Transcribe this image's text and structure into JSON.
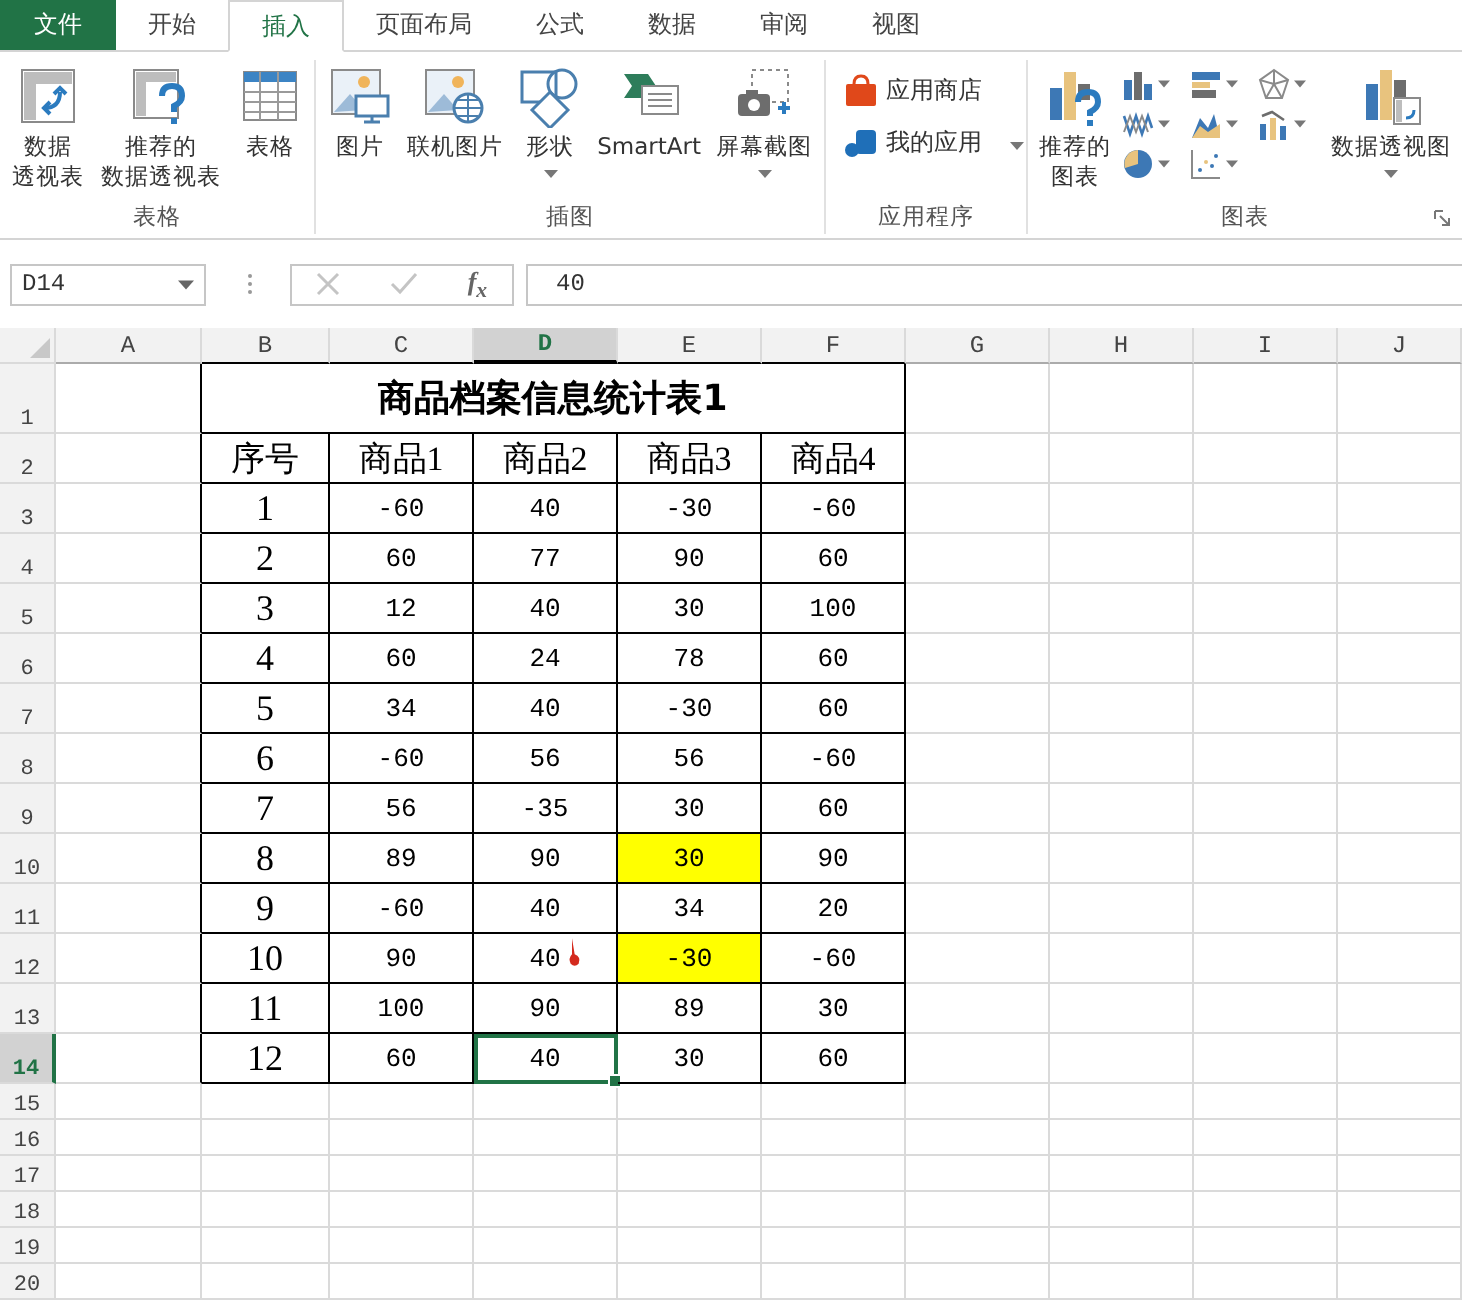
{
  "tabs": [
    {
      "label": "文件",
      "kind": "file",
      "selected": false
    },
    {
      "label": "开始",
      "kind": "tab",
      "selected": false
    },
    {
      "label": "插入",
      "kind": "tab",
      "selected": true
    },
    {
      "label": "页面布局",
      "kind": "tab",
      "selected": false
    },
    {
      "label": "公式",
      "kind": "tab",
      "selected": false
    },
    {
      "label": "数据",
      "kind": "tab",
      "selected": false
    },
    {
      "label": "审阅",
      "kind": "tab",
      "selected": false
    },
    {
      "label": "视图",
      "kind": "tab",
      "selected": false
    }
  ],
  "ribbon": {
    "groups": [
      {
        "label": "表格",
        "buttons": [
          {
            "lines": [
              "数据",
              "透视表"
            ],
            "kind": "large",
            "dropdown": false
          },
          {
            "lines": [
              "推荐的",
              "数据透视表"
            ],
            "kind": "large",
            "dropdown": false
          },
          {
            "lines": [
              "表格"
            ],
            "kind": "large",
            "dropdown": false
          }
        ]
      },
      {
        "label": "插图",
        "buttons": [
          {
            "lines": [
              "图片"
            ],
            "kind": "large",
            "dropdown": false
          },
          {
            "lines": [
              "联机图片"
            ],
            "kind": "large",
            "dropdown": false
          },
          {
            "lines": [
              "形状"
            ],
            "kind": "large",
            "dropdown": true
          },
          {
            "lines": [
              "SmartArt"
            ],
            "kind": "large",
            "dropdown": false
          },
          {
            "lines": [
              "屏幕截图"
            ],
            "kind": "large",
            "dropdown": true
          }
        ]
      },
      {
        "label": "应用程序",
        "buttons": [
          {
            "lines": [
              "应用商店"
            ],
            "kind": "row",
            "dropdown": false
          },
          {
            "lines": [
              "我的应用"
            ],
            "kind": "row",
            "dropdown": true
          }
        ]
      },
      {
        "label": "图表",
        "buttons": [
          {
            "lines": [
              "推荐的",
              "图表"
            ],
            "kind": "large",
            "dropdown": false
          },
          {
            "kind": "chart-grid",
            "dropdown": true
          },
          {
            "lines": [
              "数据透视图"
            ],
            "kind": "large",
            "dropdown": true
          }
        ]
      }
    ]
  },
  "formula_bar": {
    "name_box": "D14",
    "fx": "f$_{x}$",
    "value": "40"
  },
  "columns": [
    {
      "label": "A",
      "selected": false
    },
    {
      "label": "B",
      "selected": false
    },
    {
      "label": "C",
      "selected": false
    },
    {
      "label": "D",
      "selected": true
    },
    {
      "label": "E",
      "selected": false
    },
    {
      "label": "F",
      "selected": false
    },
    {
      "label": "G",
      "selected": false
    },
    {
      "label": "H",
      "selected": false
    },
    {
      "label": "I",
      "selected": false
    },
    {
      "label": "J",
      "selected": false
    }
  ],
  "row_numbers": [
    {
      "label": "1",
      "selected": false
    },
    {
      "label": "2",
      "selected": false
    },
    {
      "label": "3",
      "selected": false
    },
    {
      "label": "4",
      "selected": false
    },
    {
      "label": "5",
      "selected": false
    },
    {
      "label": "6",
      "selected": false
    },
    {
      "label": "7",
      "selected": false
    },
    {
      "label": "8",
      "selected": false
    },
    {
      "label": "9",
      "selected": false
    },
    {
      "label": "10",
      "selected": false
    },
    {
      "label": "11",
      "selected": false
    },
    {
      "label": "12",
      "selected": false
    },
    {
      "label": "13",
      "selected": false
    },
    {
      "label": "14",
      "selected": true
    },
    {
      "label": "15",
      "selected": false
    },
    {
      "label": "16",
      "selected": false
    },
    {
      "label": "17",
      "selected": false
    },
    {
      "label": "18",
      "selected": false
    },
    {
      "label": "19",
      "selected": false
    },
    {
      "label": "20",
      "selected": false
    }
  ],
  "table": {
    "title": "商品档案信息统计表1",
    "headers": [
      "序号",
      "商品1",
      "商品2",
      "商品3",
      "商品4"
    ],
    "rows": [
      {
        "seq": "1",
        "cells": [
          {
            "text": "-60",
            "highlighted": false,
            "selected": false
          },
          {
            "text": "40",
            "highlighted": false,
            "selected": false
          },
          {
            "text": "-30",
            "highlighted": false,
            "selected": false
          },
          {
            "text": "-60",
            "highlighted": false,
            "selected": false
          }
        ]
      },
      {
        "seq": "2",
        "cells": [
          {
            "text": "60",
            "highlighted": false,
            "selected": false
          },
          {
            "text": "77",
            "highlighted": false,
            "selected": false
          },
          {
            "text": "90",
            "highlighted": false,
            "selected": false
          },
          {
            "text": "60",
            "highlighted": false,
            "selected": false
          }
        ]
      },
      {
        "seq": "3",
        "cells": [
          {
            "text": "12",
            "highlighted": false,
            "selected": false
          },
          {
            "text": "40",
            "highlighted": false,
            "selected": false
          },
          {
            "text": "30",
            "highlighted": false,
            "selected": false
          },
          {
            "text": "100",
            "highlighted": false,
            "selected": false
          }
        ]
      },
      {
        "seq": "4",
        "cells": [
          {
            "text": "60",
            "highlighted": false,
            "selected": false
          },
          {
            "text": "24",
            "highlighted": false,
            "selected": false
          },
          {
            "text": "78",
            "highlighted": false,
            "selected": false
          },
          {
            "text": "60",
            "highlighted": false,
            "selected": false
          }
        ]
      },
      {
        "seq": "5",
        "cells": [
          {
            "text": "34",
            "highlighted": false,
            "selected": false
          },
          {
            "text": "40",
            "highlighted": false,
            "selected": false
          },
          {
            "text": "-30",
            "highlighted": false,
            "selected": false
          },
          {
            "text": "60",
            "highlighted": false,
            "selected": false
          }
        ]
      },
      {
        "seq": "6",
        "cells": [
          {
            "text": "-60",
            "highlighted": false,
            "selected": false
          },
          {
            "text": "56",
            "highlighted": false,
            "selected": false
          },
          {
            "text": "56",
            "highlighted": false,
            "selected": false
          },
          {
            "text": "-60",
            "highlighted": false,
            "selected": false
          }
        ]
      },
      {
        "seq": "7",
        "cells": [
          {
            "text": "56",
            "highlighted": false,
            "selected": false
          },
          {
            "text": "-35",
            "highlighted": false,
            "selected": false
          },
          {
            "text": "30",
            "highlighted": false,
            "selected": false
          },
          {
            "text": "60",
            "highlighted": false,
            "selected": false
          }
        ]
      },
      {
        "seq": "8",
        "cells": [
          {
            "text": "89",
            "highlighted": false,
            "selected": false
          },
          {
            "text": "90",
            "highlighted": false,
            "selected": false
          },
          {
            "text": "30",
            "highlighted": true,
            "selected": false
          },
          {
            "text": "90",
            "highlighted": false,
            "selected": false
          }
        ]
      },
      {
        "seq": "9",
        "cells": [
          {
            "text": "-60",
            "highlighted": false,
            "selected": false
          },
          {
            "text": "40",
            "highlighted": false,
            "selected": false
          },
          {
            "text": "34",
            "highlighted": false,
            "selected": false
          },
          {
            "text": "20",
            "highlighted": false,
            "selected": false
          }
        ]
      },
      {
        "seq": "10",
        "cells": [
          {
            "text": "90",
            "highlighted": false,
            "selected": false
          },
          {
            "text": "40",
            "highlighted": false,
            "selected": false
          },
          {
            "text": "-30",
            "highlighted": true,
            "selected": false
          },
          {
            "text": "-60",
            "highlighted": false,
            "selected": false
          }
        ]
      },
      {
        "seq": "11",
        "cells": [
          {
            "text": "100",
            "highlighted": false,
            "selected": false
          },
          {
            "text": "90",
            "highlighted": false,
            "selected": false
          },
          {
            "text": "89",
            "highlighted": false,
            "selected": false
          },
          {
            "text": "30",
            "highlighted": false,
            "selected": false
          }
        ]
      },
      {
        "seq": "12",
        "cells": [
          {
            "text": "60",
            "highlighted": false,
            "selected": false
          },
          {
            "text": "40",
            "highlighted": false,
            "selected": true
          },
          {
            "text": "30",
            "highlighted": false,
            "selected": false
          },
          {
            "text": "60",
            "highlighted": false,
            "selected": false
          }
        ]
      }
    ]
  }
}
